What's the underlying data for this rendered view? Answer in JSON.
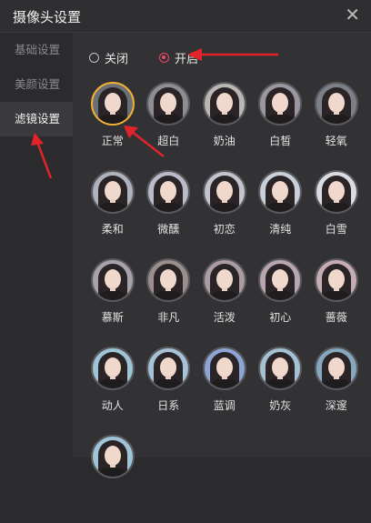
{
  "window": {
    "title": "摄像头设置",
    "close_icon": "close-icon"
  },
  "sidebar": {
    "items": [
      {
        "label": "基础设置",
        "active": false
      },
      {
        "label": "美颜设置",
        "active": false
      },
      {
        "label": "滤镜设置",
        "active": true
      }
    ]
  },
  "filter_toggle": {
    "off_label": "关闭",
    "on_label": "开启",
    "selected": "on"
  },
  "filters": [
    {
      "label": "正常",
      "bg": "#6b6f78",
      "selected": true
    },
    {
      "label": "超白",
      "bg": "#8d8d94"
    },
    {
      "label": "奶油",
      "bg": "#b9b6b4"
    },
    {
      "label": "白皙",
      "bg": "#9a97a0"
    },
    {
      "label": "轻氧",
      "bg": "#7c8088"
    },
    {
      "label": "柔和",
      "bg": "#aeb3be"
    },
    {
      "label": "微醺",
      "bg": "#b9bcc8"
    },
    {
      "label": "初恋",
      "bg": "#c4c4cf"
    },
    {
      "label": "清纯",
      "bg": "#c9d0d9"
    },
    {
      "label": "白雪",
      "bg": "#d9dde3"
    },
    {
      "label": "慕斯",
      "bg": "#a8a3ab"
    },
    {
      "label": "非凡",
      "bg": "#9b8f8d"
    },
    {
      "label": "活泼",
      "bg": "#ab9ca3"
    },
    {
      "label": "初心",
      "bg": "#b8a7b0"
    },
    {
      "label": "蔷薇",
      "bg": "#c6adb3"
    },
    {
      "label": "动人",
      "bg": "#9ec4d6"
    },
    {
      "label": "日系",
      "bg": "#a5c2d6"
    },
    {
      "label": "蓝调",
      "bg": "#8ca4d6"
    },
    {
      "label": "奶灰",
      "bg": "#a2c2d4"
    },
    {
      "label": "深邃",
      "bg": "#86a7c0"
    },
    {
      "label": "",
      "bg": "#9ec4d6"
    }
  ],
  "colors": {
    "accent": "#e84a6a",
    "selected_ring": "#f1b133",
    "annotation_arrow": "#e2232a"
  }
}
